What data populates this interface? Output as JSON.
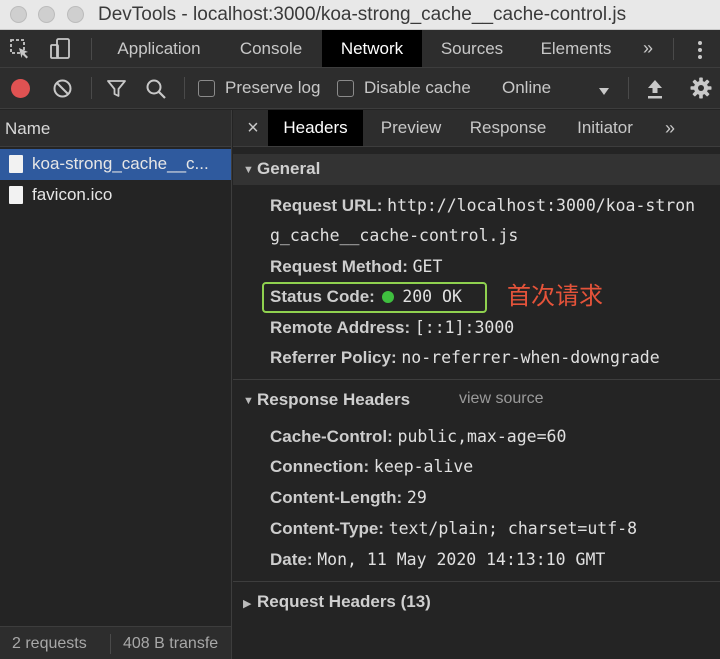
{
  "window": {
    "title": "DevTools - localhost:3000/koa-strong_cache__cache-control.js"
  },
  "main_tabs": [
    {
      "label": "Application"
    },
    {
      "label": "Console"
    },
    {
      "label": "Network"
    },
    {
      "label": "Sources"
    },
    {
      "label": "Elements"
    }
  ],
  "main_tabs_more": "»",
  "toolbar": {
    "preserve_log": "Preserve log",
    "disable_cache": "Disable cache",
    "throttling": "Online"
  },
  "requests": {
    "header": "Name",
    "items": [
      {
        "label": "koa-strong_cache__c..."
      },
      {
        "label": "favicon.ico"
      }
    ],
    "status": {
      "count": "2 requests",
      "transferred": "408 B transfe"
    }
  },
  "detail_tabs": [
    {
      "label": "Headers"
    },
    {
      "label": "Preview"
    },
    {
      "label": "Response"
    },
    {
      "label": "Initiator"
    }
  ],
  "detail_tabs_more": "»",
  "close_glyph": "×",
  "general": {
    "title": "General",
    "request_url_key": "Request URL:",
    "request_url_line1": "http://localhost:3000/koa-stron",
    "request_url_line2": "g_cache__cache-control.js",
    "request_method_key": "Request Method:",
    "request_method": "GET",
    "status_code_key": "Status Code:",
    "status_code": "200 OK",
    "status_color": "#3fbf3f",
    "remote_address_key": "Remote Address:",
    "remote_address": "[::1]:3000",
    "referrer_policy_key": "Referrer Policy:",
    "referrer_policy": "no-referrer-when-downgrade"
  },
  "annotation": {
    "text": "首次请求",
    "color": "#e5533a",
    "highlight_color": "#8fd14f"
  },
  "response_headers": {
    "title": "Response Headers",
    "view_source": "view source",
    "items": [
      {
        "key": "Cache-Control:",
        "value": "public,max-age=60"
      },
      {
        "key": "Connection:",
        "value": "keep-alive"
      },
      {
        "key": "Content-Length:",
        "value": "29"
      },
      {
        "key": "Content-Type:",
        "value": "text/plain; charset=utf-8"
      },
      {
        "key": "Date:",
        "value": "Mon, 11 May 2020 14:13:10 GMT"
      }
    ]
  },
  "request_headers": {
    "title": "Request Headers (13)"
  },
  "colors": {
    "selected_row": "#2f5a9e",
    "record_button": "#e05252",
    "active_tab_bg": "#000000"
  }
}
